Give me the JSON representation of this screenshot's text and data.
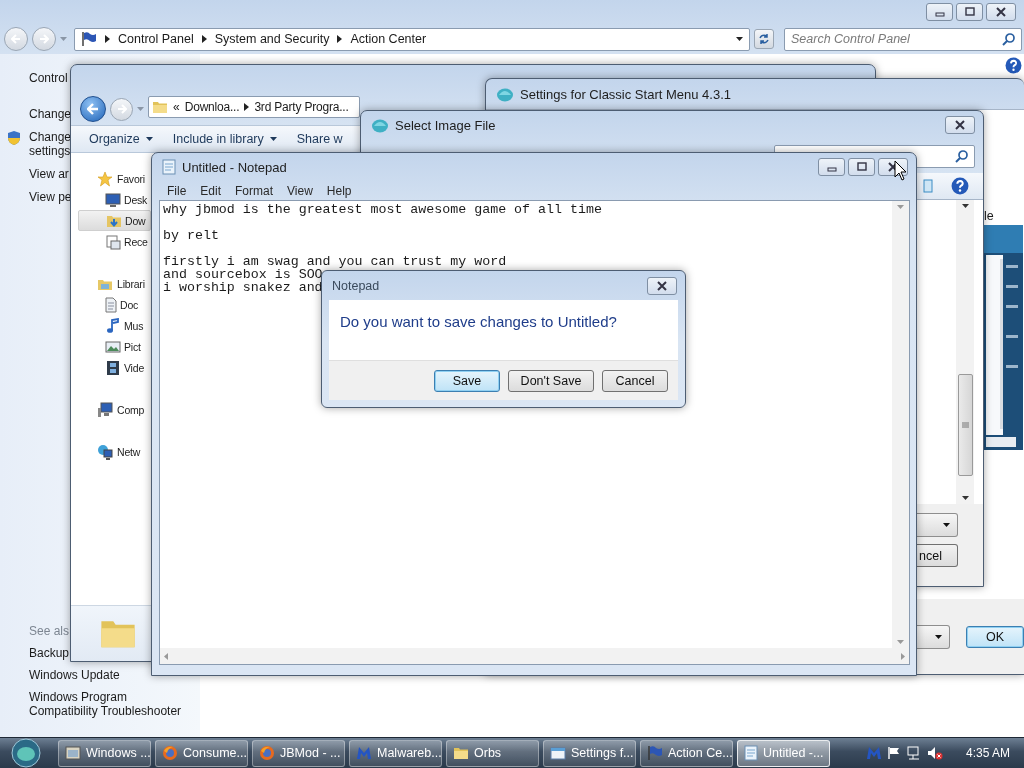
{
  "control_panel": {
    "breadcrumb": [
      "Control Panel",
      "System and Security",
      "Action Center"
    ],
    "search": {
      "placeholder": "Search Control Panel"
    },
    "tasks": [
      {
        "text": "Control",
        "kind": "link"
      },
      {
        "text": "Change",
        "kind": "link"
      },
      {
        "text": "Change settings",
        "kind": "shield"
      },
      {
        "text": "View ar",
        "kind": "link"
      },
      {
        "text": "View pe",
        "kind": "link"
      }
    ],
    "see_also": {
      "heading": "See als",
      "links": [
        "Backup",
        "Windows Update",
        "Windows Program Compatibility Troubleshooter"
      ]
    }
  },
  "explorer": {
    "address": {
      "prefix": "«",
      "parts": [
        "Downloa...",
        "3rd Party Progra..."
      ]
    },
    "toolbar": [
      {
        "label": "Organize",
        "menu": true
      },
      {
        "label": "Include in library",
        "menu": true
      },
      {
        "label": "Share w",
        "menu": false
      }
    ],
    "nav": [
      {
        "label": "Favori",
        "kind": "star",
        "selected": false,
        "children": [
          {
            "label": "Desk",
            "kind": "desktop",
            "selected": false
          },
          {
            "label": "Dow",
            "kind": "downloads",
            "selected": true
          },
          {
            "label": "Rece",
            "kind": "recent",
            "selected": false
          }
        ]
      },
      {
        "label": "Librari",
        "kind": "library",
        "selected": false,
        "children": [
          {
            "label": "Doc",
            "kind": "document",
            "selected": false
          },
          {
            "label": "Mus",
            "kind": "music",
            "selected": false
          },
          {
            "label": "Pict",
            "kind": "pictures",
            "selected": false
          },
          {
            "label": "Vide",
            "kind": "videos",
            "selected": false
          }
        ]
      },
      {
        "label": "Comp",
        "kind": "computer",
        "selected": false
      },
      {
        "label": "Netw",
        "kind": "network",
        "selected": false
      }
    ]
  },
  "settings": {
    "title": "Settings for Classic Start Menu 4.3.1",
    "label": "le",
    "ok": {
      "label": "OK",
      "default": true
    }
  },
  "select_image": {
    "title": "Select Image File",
    "button": "ncel"
  },
  "notepad": {
    "title": "Untitled - Notepad",
    "menu": [
      "File",
      "Edit",
      "Format",
      "View",
      "Help"
    ],
    "paragraphs": [
      [
        "why jbmod is the greatest most awesome game of all time"
      ],
      [
        "by relt"
      ],
      [
        "firstly i am swag and you can trust my word",
        "and sourcebox is SOO",
        "i worship snakez and"
      ]
    ]
  },
  "dialog": {
    "title": "Notepad",
    "message": "Do you want to save changes to Untitled?",
    "buttons": [
      {
        "label": "Save",
        "default": true
      },
      {
        "label": "Don't Save",
        "default": false
      },
      {
        "label": "Cancel",
        "default": false
      }
    ]
  },
  "taskbar": {
    "items": [
      {
        "label": "Windows ...",
        "kind": "explorer",
        "selected": false
      },
      {
        "label": "Consume...",
        "kind": "firefox",
        "selected": false
      },
      {
        "label": "JBMod - ...",
        "kind": "firefox",
        "selected": false
      },
      {
        "label": "Malwareb...",
        "kind": "malwarebytes",
        "selected": false
      },
      {
        "label": "Orbs",
        "kind": "folder",
        "selected": false
      },
      {
        "label": "Settings f...",
        "kind": "settings",
        "selected": false
      },
      {
        "label": "Action Ce...",
        "kind": "flag",
        "selected": false
      },
      {
        "label": "Untitled -...",
        "kind": "notepad",
        "selected": true
      }
    ],
    "clock": "4:35 AM"
  }
}
